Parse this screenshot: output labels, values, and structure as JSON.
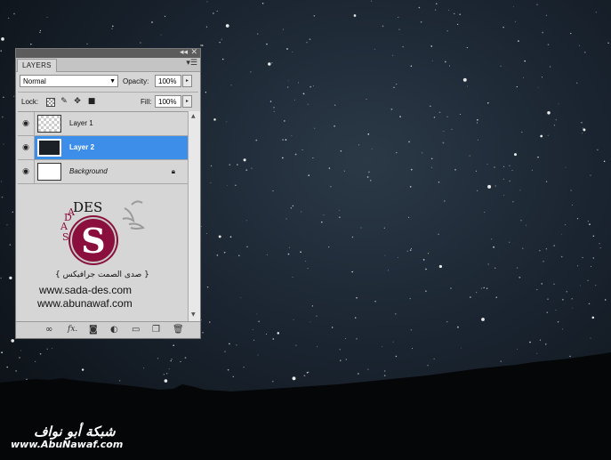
{
  "colors": {
    "sky_center": "#2b3947",
    "sky_edge": "#0b0f14",
    "panel_bg": "#d6d6d6",
    "selection": "#3d8ee8",
    "logo_maroon": "#8a0f3c"
  },
  "panel": {
    "tab_label": "LAYERS",
    "blend_mode": "Normal",
    "opacity_label": "Opacity:",
    "opacity_value": "100%",
    "lock_label": "Lock:",
    "fill_label": "Fill:",
    "fill_value": "100%",
    "lock_icons": [
      "transparent-pixels-lock-icon",
      "brush-lock-icon",
      "move-lock-icon",
      "padlock-icon"
    ],
    "layers": [
      {
        "name": "Layer 1",
        "visible": true,
        "selected": false,
        "thumb": "transparent"
      },
      {
        "name": "Layer 2",
        "visible": true,
        "selected": true,
        "thumb": "dark"
      },
      {
        "name": "Background",
        "visible": true,
        "selected": false,
        "thumb": "white",
        "locked": true
      }
    ],
    "bottom_icons": [
      "link-icon",
      "fx-icon",
      "mask-icon",
      "adjustment-icon",
      "folder-icon",
      "new-layer-icon",
      "trash-icon"
    ]
  },
  "logo": {
    "letters_top": "DES",
    "letters_left_1": "A",
    "letters_left_2": "D",
    "letters_left_3": "A",
    "letters_left_4": "S",
    "circle_letter": "S",
    "arabic_line": "{ صدى الصمت جرافيكس }",
    "url1": "www.sada-des.com",
    "url2": "www.abunawaf.com"
  },
  "watermark": {
    "arabic": "شبكة أبو نواف",
    "url": "www.AbuNawaf.com"
  }
}
